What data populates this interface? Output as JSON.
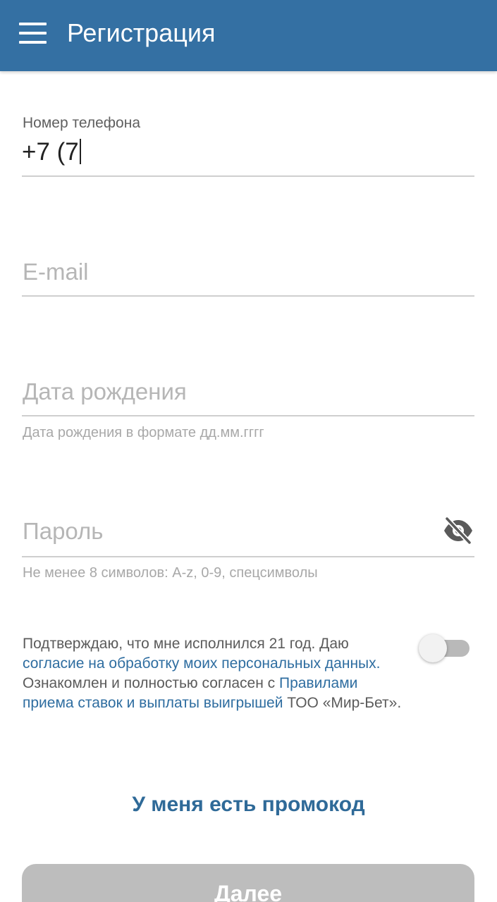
{
  "appbar": {
    "title": "Регистрация",
    "background": "#3470a3",
    "menu_icon": "hamburger-menu-icon"
  },
  "form": {
    "phone": {
      "label": "Номер телефона",
      "value": "+7 (7"
    },
    "email": {
      "placeholder": "E-mail"
    },
    "birthdate": {
      "placeholder": "Дата рождения",
      "helper": "Дата рождения в формате дд.мм.гггг"
    },
    "password": {
      "placeholder": "Пароль",
      "helper": "Не менее 8 символов: A-z, 0-9, спецсимволы",
      "visibility_icon": "eye-off-icon"
    }
  },
  "consent": {
    "text_1": "Подтверждаю, что мне исполнился 21 год. Даю ",
    "link_1": "согласие на обработку моих персональных данных.",
    "text_2": " Ознакомлен и полностью согласен с ",
    "link_2": "Правилами приема ставок и выплаты выигрышей",
    "text_3": "  ТОО «Мир-Бет».",
    "toggle_on": false,
    "link_color": "#2e6da0"
  },
  "promo": {
    "label": "У меня есть промокод",
    "color": "#2f6a98"
  },
  "next_button": {
    "label": "Далее",
    "enabled": false
  }
}
